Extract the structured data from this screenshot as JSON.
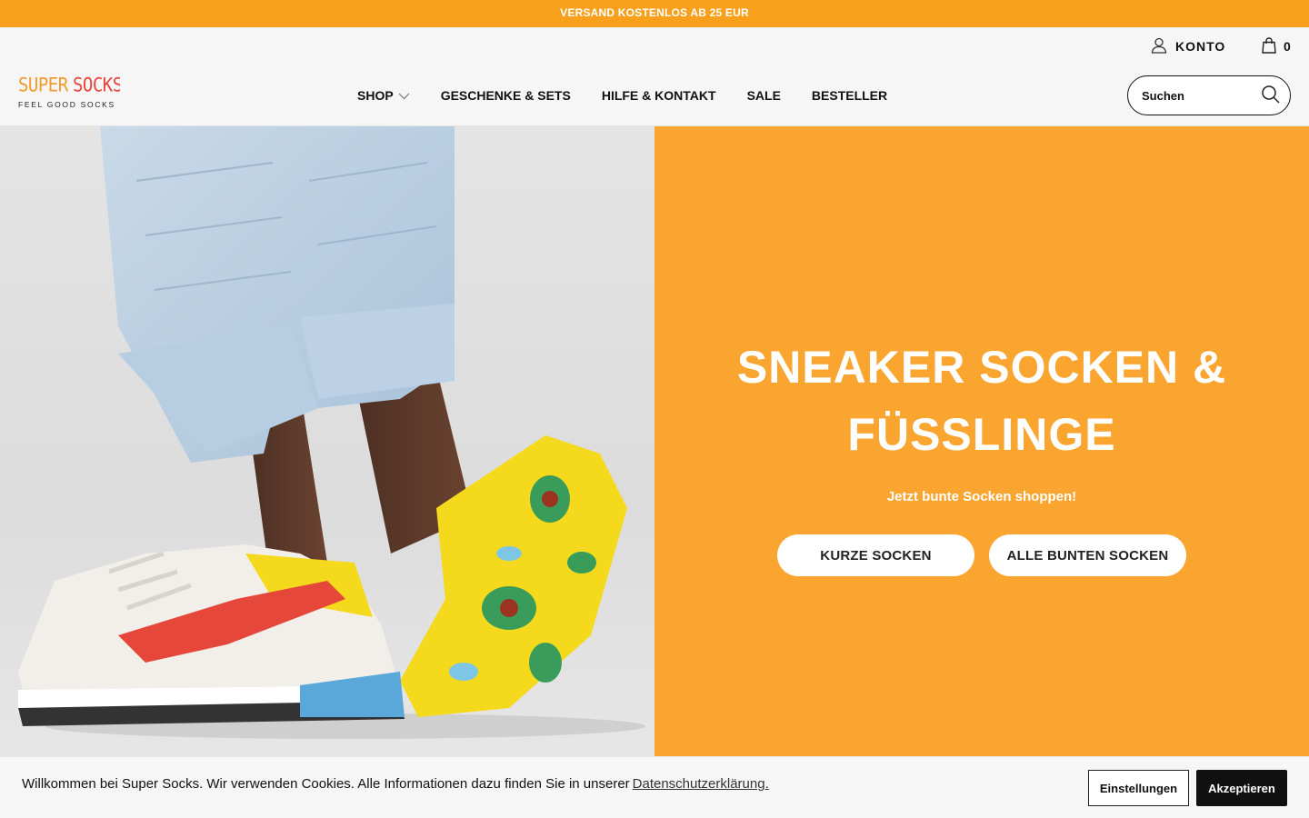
{
  "announcement": "VERSAND KOSTENLOS AB 25 EUR",
  "header": {
    "logo": {
      "top": "SUPER SOCKS",
      "tagline": "FEEL GOOD SOCKS"
    },
    "account_label": "KONTO",
    "cart_count": "0",
    "nav": [
      {
        "label": "SHOP",
        "has_dropdown": true
      },
      {
        "label": "GESCHENKE & SETS"
      },
      {
        "label": "HILFE & KONTAKT"
      },
      {
        "label": "SALE"
      },
      {
        "label": "BESTELLER"
      }
    ],
    "search": {
      "placeholder": "Suchen",
      "value": ""
    }
  },
  "hero": {
    "image_alt": "Person mit Jeans, Sneaker und gelben Avocado-Sneakersocken",
    "title_line1": "SNEAKER SOCKEN &",
    "title_line2": "FÜSSLINGE",
    "subtitle": "Jetzt bunte Socken shoppen!",
    "buttons": [
      {
        "label": "KURZE SOCKEN"
      },
      {
        "label": "ALLE BUNTEN SOCKEN"
      }
    ],
    "panel_color": "#f9a530"
  },
  "cookie_banner": {
    "text": "Willkommen bei Super Socks. Wir verwenden Cookies. Alle Informationen dazu finden Sie in unserer",
    "link": "Datenschutzerklärung.",
    "settings_label": "Einstellungen",
    "accept_label": "Akzeptieren"
  },
  "colors": {
    "accent": "#f8a01c",
    "dark": "#111111"
  },
  "icons": [
    "user-icon",
    "bag-icon",
    "search-icon",
    "chevron-down-icon"
  ]
}
